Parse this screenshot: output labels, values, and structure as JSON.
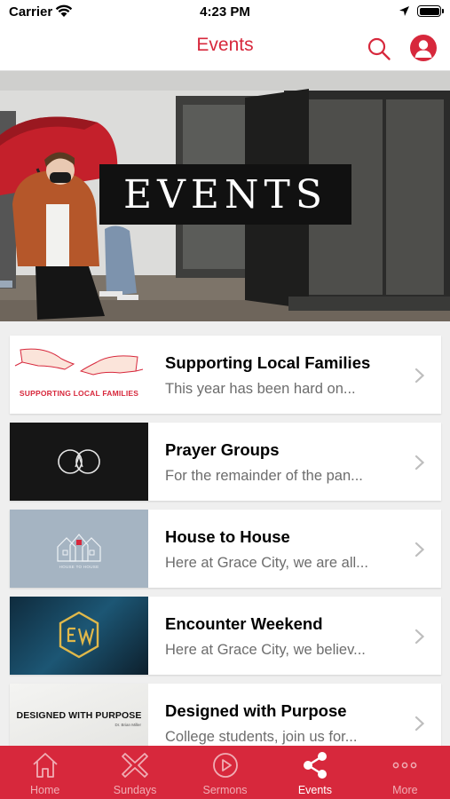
{
  "status_bar": {
    "carrier": "Carrier",
    "time": "4:23 PM"
  },
  "nav": {
    "title": "Events"
  },
  "hero": {
    "title": "EVENTS"
  },
  "events": [
    {
      "title": "Supporting Local Families",
      "description": "This year has been hard on...",
      "thumb_text": "SUPPORTING LOCAL FAMILIES"
    },
    {
      "title": "Prayer Groups",
      "description": "For the remainder of the pan..."
    },
    {
      "title": "House to House",
      "description": "Here at Grace City, we are all...",
      "thumb_text": "HOUSE TO HOUSE"
    },
    {
      "title": "Encounter Weekend",
      "description": "Here at Grace City, we believ..."
    },
    {
      "title": "Designed with Purpose",
      "description": "College students, join us for...",
      "thumb_text": "DESIGNED WITH PURPOSE",
      "thumb_subtext": "Dr. Brian Miller"
    }
  ],
  "tabs": [
    {
      "label": "Home",
      "icon": "home-icon",
      "active": false
    },
    {
      "label": "Sundays",
      "icon": "sundays-icon",
      "active": false
    },
    {
      "label": "Sermons",
      "icon": "play-circle-icon",
      "active": false
    },
    {
      "label": "Events",
      "icon": "share-icon",
      "active": true
    },
    {
      "label": "More",
      "icon": "more-dots-icon",
      "active": false
    }
  ],
  "colors": {
    "accent": "#d7283c",
    "background": "#efefef",
    "card": "#ffffff",
    "secondary_text": "#6d6d6d"
  }
}
